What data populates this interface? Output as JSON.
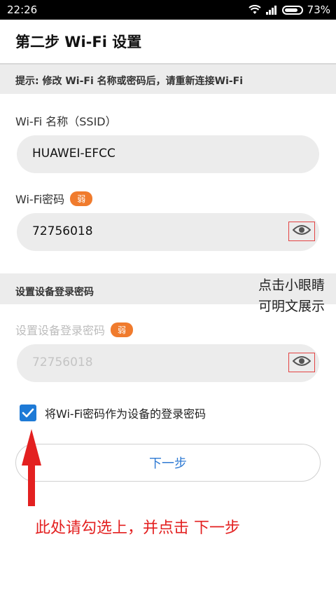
{
  "status": {
    "time": "22:26",
    "battery": "73%"
  },
  "header": {
    "title": "第二步 Wi-Fi 设置"
  },
  "hint": "提示: 修改 Wi-Fi 名称或密码后，请重新连接Wi-Fi",
  "ssid": {
    "label": "Wi-Fi 名称（SSID）",
    "value": "HUAWEI-EFCC"
  },
  "wifi_password": {
    "label": "Wi-Fi密码",
    "strength": "弱",
    "value": "72756018"
  },
  "device_section": {
    "title": "设置设备登录密码"
  },
  "device_password": {
    "label": "设置设备登录密码",
    "strength": "弱",
    "value": "72756018"
  },
  "tip": {
    "line1": "点击小眼睛",
    "line2": "可明文展示"
  },
  "checkbox": {
    "label": "将Wi-Fi密码作为设备的登录密码",
    "checked": true
  },
  "next_button": {
    "label": "下一步"
  },
  "instruction": "此处请勾选上，并点击 下一步",
  "colors": {
    "accent": "#1e7ad6",
    "badge": "#f07b2d",
    "annotation": "#e32020"
  }
}
